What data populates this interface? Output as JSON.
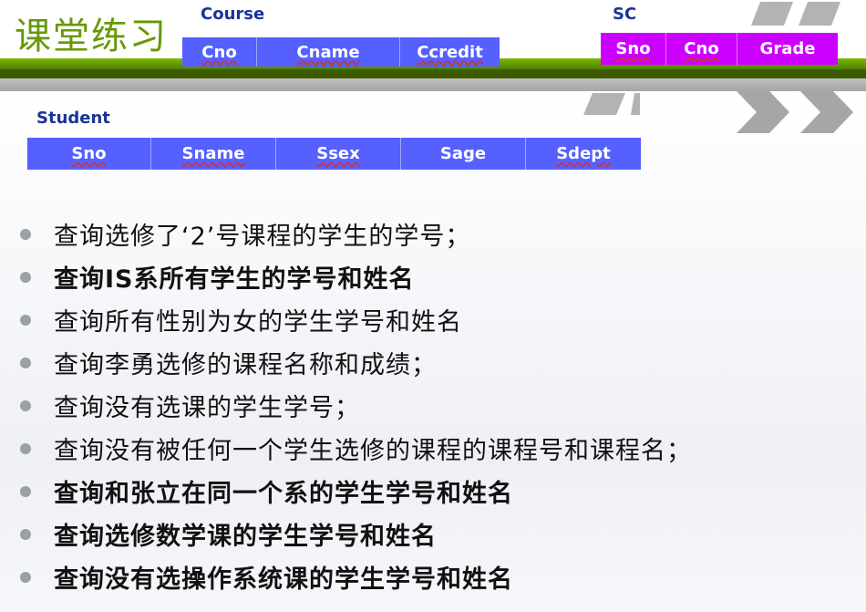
{
  "slide": {
    "title": "课堂练习"
  },
  "tables": {
    "course": {
      "name": "Course",
      "columns": [
        "Cno",
        "Cname",
        "Ccredit"
      ]
    },
    "sc": {
      "name": "SC",
      "columns": [
        "Sno",
        "Cno",
        "Grade"
      ]
    },
    "student": {
      "name": "Student",
      "columns": [
        "Sno",
        "Sname",
        "Ssex",
        "Sage",
        "Sdept"
      ]
    }
  },
  "exercises": [
    "查询选修了‘2’号课程的学生的学号；",
    "查询IS系所有学生的学号和姓名",
    "查询所有性别为女的学生学号和姓名",
    "查询李勇选修的课程名称和成绩；",
    "查询没有选课的学生学号；",
    "查询没有被任何一个学生选修的课程的课程号和课程名；",
    "查询和张立在同一个系的学生学号和姓名",
    "查询选修数学课的学生学号和姓名",
    "查询没有选操作系统课的学生学号和姓名"
  ],
  "colors": {
    "title_green": "#669900",
    "table_blue": "#5560ff",
    "table_magenta": "#cc00ff",
    "caption_navy": "#1a3399"
  },
  "icons": [
    "chevron-decoration-icon",
    "bullet-dot-icon"
  ]
}
